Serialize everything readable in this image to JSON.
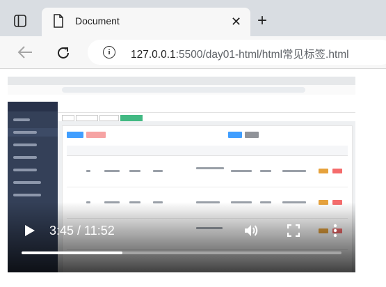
{
  "browser": {
    "tab_title": "Document",
    "url_host": "127.0.0.1",
    "url_rest": ":5500/day01-html/html常见标签.html"
  },
  "video": {
    "current_time": "3:45",
    "duration": "11:52",
    "time_display": "3:45 / 11:52",
    "progress_fraction": 0.316
  }
}
